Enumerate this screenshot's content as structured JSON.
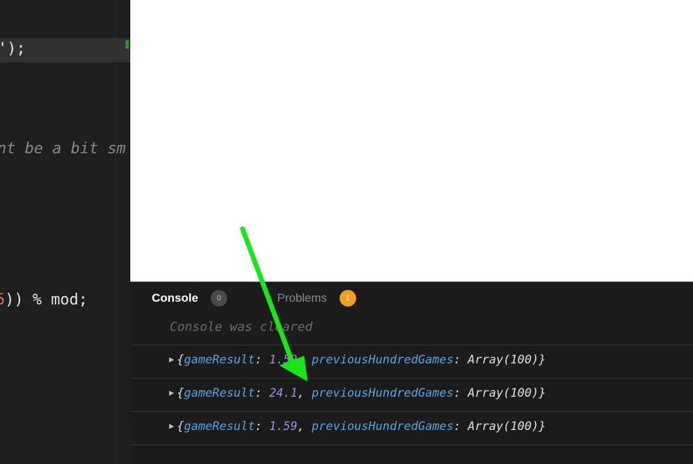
{
  "editor": {
    "line1": "');",
    "line2": "nt be a bit sm",
    "line3_red": "5",
    "line3_rest": ")) % mod;"
  },
  "console_panel": {
    "tabs": [
      {
        "label": "Console",
        "badge": "0"
      },
      {
        "label": "Problems",
        "badge": "1"
      }
    ],
    "cleared_message": "Console was cleared",
    "logs": [
      {
        "open": "{",
        "key1": "gameResult",
        "sep1": ": ",
        "value1": "1.59",
        "sep2": ", ",
        "key2": "previousHundredGames",
        "sep3": ": ",
        "value2": "Array(100)",
        "close": "}"
      },
      {
        "open": "{",
        "key1": "gameResult",
        "sep1": ": ",
        "value1": "24.1",
        "sep2": ", ",
        "key2": "previousHundredGames",
        "sep3": ": ",
        "value2": "Array(100)",
        "close": "}"
      },
      {
        "open": "{",
        "key1": "gameResult",
        "sep1": ": ",
        "value1": "1.59",
        "sep2": ", ",
        "key2": "previousHundredGames",
        "sep3": ": ",
        "value2": "Array(100)",
        "close": "}"
      }
    ],
    "expand_icon": "caret-right-icon"
  },
  "colors": {
    "arrow": "#19e619",
    "badge_orange": "#f0a020",
    "key_blue": "#56a6e8",
    "number_purple": "#a08ee8"
  }
}
